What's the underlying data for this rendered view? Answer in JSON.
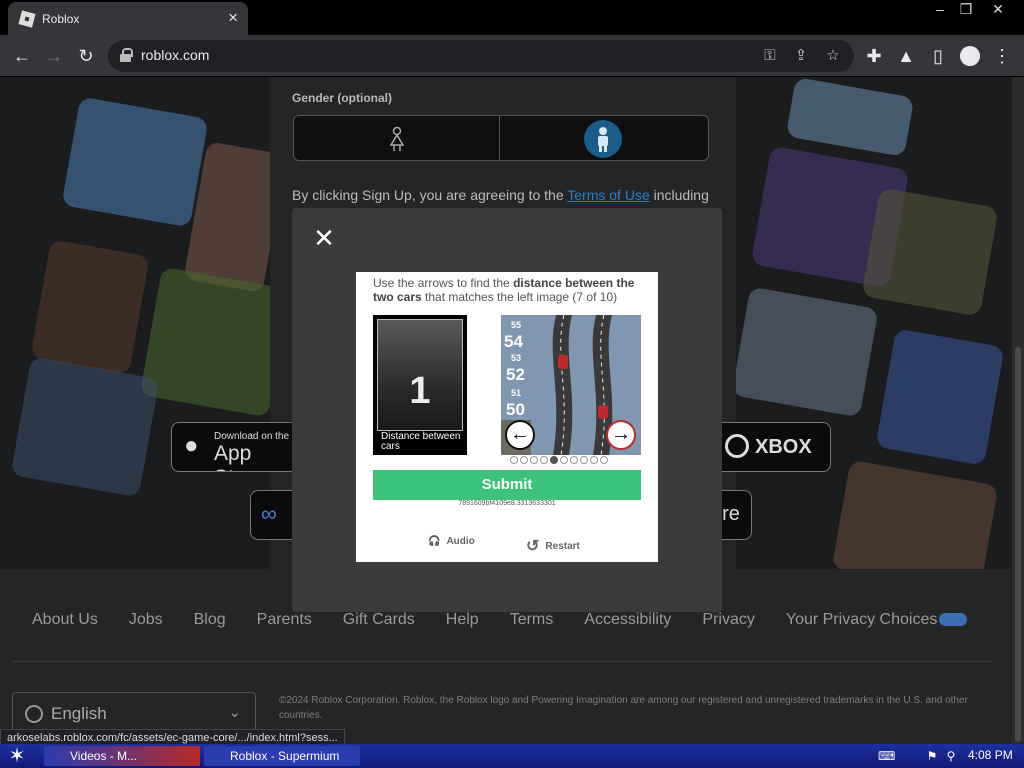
{
  "browser": {
    "tab_title": "Roblox",
    "url": "roblox.com",
    "status_url": "arkoselabs.roblox.com/fc/assets/ec-game-core/.../index.html?sess..."
  },
  "signup": {
    "gender_label": "Gender (optional)",
    "agree_prefix": "By clicking Sign Up, you are agreeing to the ",
    "terms_link": "Terms of Use",
    "agree_suffix": " including"
  },
  "stores": {
    "appstore_small": "Download on the",
    "appstore_big": "App Store",
    "xbox": "XBOX",
    "store_partial": "ore"
  },
  "captcha": {
    "instruction_prefix": "Use the arrows to find the ",
    "instruction_bold": "distance between the two cars",
    "instruction_suffix": " that matches the left image (7 of 10)",
    "reference_number": "1",
    "reference_caption": "Distance between cars",
    "submit_label": "Submit",
    "token": "7891609bf4109e8.3313633301",
    "audio_label": "Audio",
    "restart_label": "Restart",
    "lane_numbers": [
      "55",
      "54",
      "53",
      "52",
      "51",
      "50"
    ],
    "current_index": 4,
    "total": 10
  },
  "footer": {
    "links": [
      "About Us",
      "Jobs",
      "Blog",
      "Parents",
      "Gift Cards",
      "Help",
      "Terms",
      "Accessibility",
      "Privacy",
      "Your Privacy Choices"
    ],
    "language": "English",
    "copyright": "©2024 Roblox Corporation. Roblox, the Roblox logo and Powering Imagination are among our registered and unregistered trademarks in the U.S. and other countries."
  },
  "taskbar": {
    "items": [
      "Videos - M...",
      "Roblox - Supermium"
    ],
    "clock": "4:08 PM"
  },
  "colors": {
    "accent_green": "#3cc37a",
    "link_blue": "#2d7ec4",
    "taskbar_blue": "#101a78"
  }
}
